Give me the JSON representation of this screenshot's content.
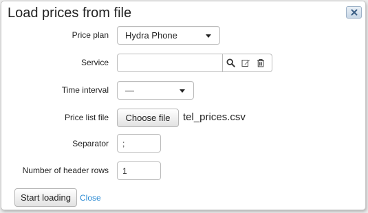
{
  "dialog": {
    "title": "Load prices from file",
    "close_icon": "close-x-icon"
  },
  "fields": {
    "price_plan": {
      "label": "Price plan",
      "value": "Hydra Phone"
    },
    "service": {
      "label": "Service",
      "value": "",
      "icons": [
        "search-icon",
        "edit-icon",
        "trash-icon"
      ]
    },
    "time_interval": {
      "label": "Time interval",
      "value": "—"
    },
    "price_list_file": {
      "label": "Price list file",
      "button": "Choose file",
      "filename": "tel_prices.csv"
    },
    "separator": {
      "label": "Separator",
      "value": ";"
    },
    "header_rows": {
      "label": "Number of header rows",
      "value": "1"
    }
  },
  "actions": {
    "start_loading": "Start loading",
    "close": "Close"
  },
  "colors": {
    "link": "#2a8ad3",
    "close_button": "#c8d7e7"
  }
}
